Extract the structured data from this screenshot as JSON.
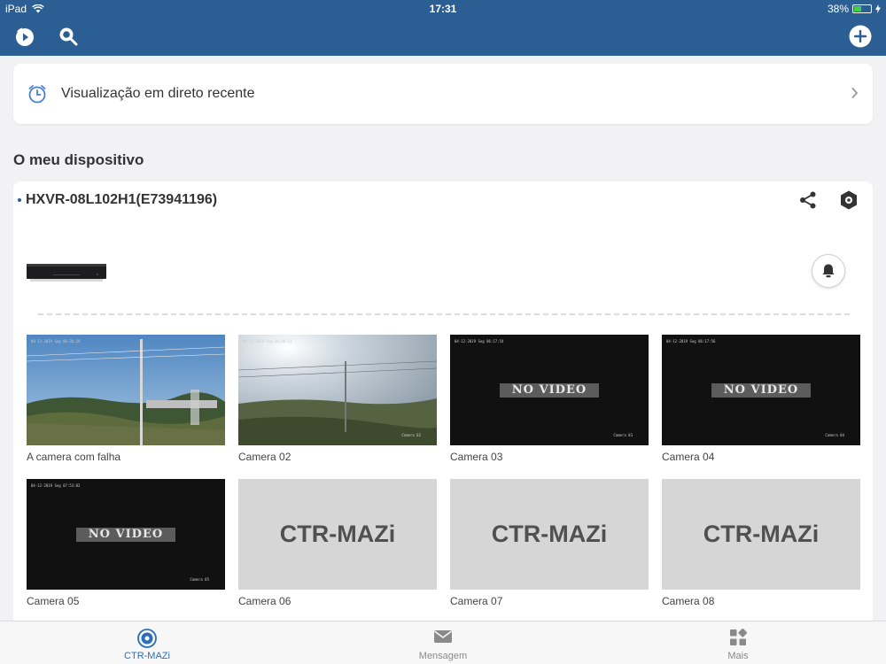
{
  "status_bar": {
    "device": "iPad",
    "time": "17:31",
    "battery": "38%"
  },
  "recent_live": {
    "label": "Visualização em direto recente"
  },
  "my_devices": {
    "title": "O meu dispositivo"
  },
  "device": {
    "name": "HXVR-08L102H1(E73941196)"
  },
  "cameras": [
    {
      "name": "A camera com falha",
      "state": "live"
    },
    {
      "name": "Camera 02",
      "state": "live"
    },
    {
      "name": "Camera 03",
      "state": "no-video",
      "overlay": "NO VIDEO"
    },
    {
      "name": "Camera 04",
      "state": "no-video",
      "overlay": "NO VIDEO"
    },
    {
      "name": "Camera 05",
      "state": "no-video",
      "overlay": "NO VIDEO"
    },
    {
      "name": "Camera 06",
      "state": "placeholder",
      "overlay": "CTR-MAZi"
    },
    {
      "name": "Camera 07",
      "state": "placeholder",
      "overlay": "CTR-MAZi"
    },
    {
      "name": "Camera 08",
      "state": "placeholder",
      "overlay": "CTR-MAZi"
    }
  ],
  "tab_bar": {
    "items": [
      {
        "label": "CTR-MAZi",
        "icon": "live-camera-icon",
        "active": true
      },
      {
        "label": "Mensagem",
        "icon": "envelope-icon",
        "active": false
      },
      {
        "label": "Mais",
        "icon": "grid-icon",
        "active": false
      }
    ]
  },
  "colors": {
    "brand": "#2b5e92",
    "active_tab": "#2b6eb5",
    "battery_fill": "#3ed14a"
  }
}
